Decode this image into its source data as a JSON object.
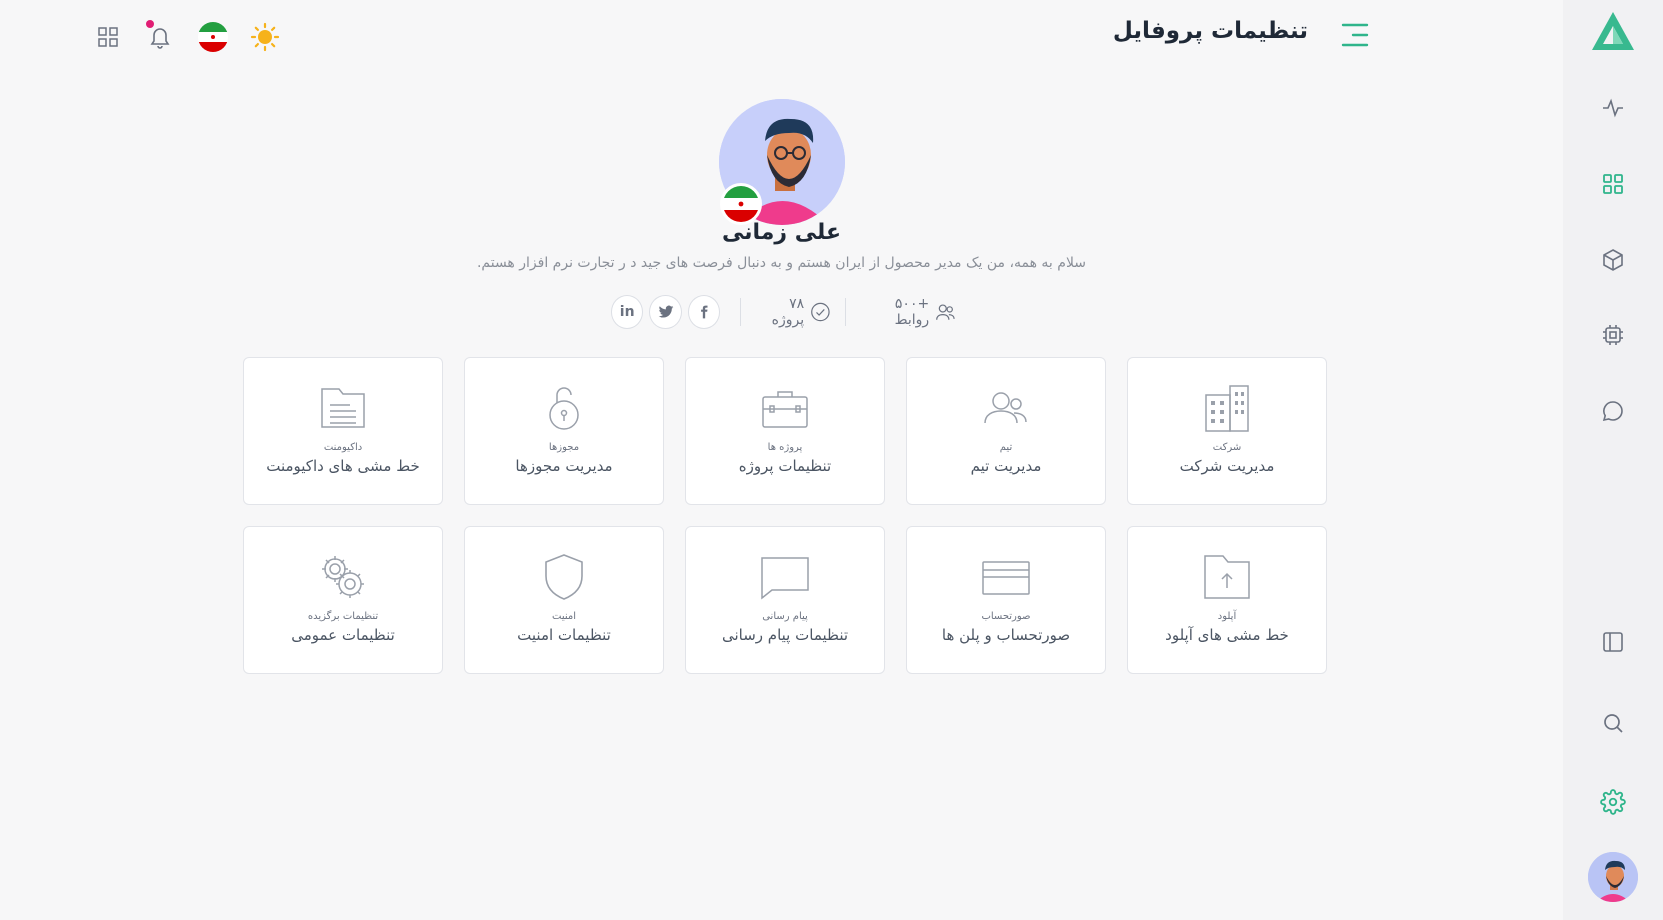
{
  "header": {
    "title": "تنظیمات پروفایل"
  },
  "profile": {
    "name": "علی زمانی",
    "bio": "سلام به همه، من یک مدیر محصول از ایران هستم و به دنبال فرصت های جید د ر تجارت نرم افزار هستم.",
    "connections": "+۵۰۰ روابط",
    "projects": "۷۸ پروژه",
    "social": {
      "linkedin": "in"
    }
  },
  "cards": [
    {
      "sub": "شرکت",
      "title": "مدیریت شرکت",
      "icon": "building-icon"
    },
    {
      "sub": "تیم",
      "title": "مدیریت تیم",
      "icon": "team-icon"
    },
    {
      "sub": "پروژه ها",
      "title": "تنظیمات پروژه",
      "icon": "briefcase-icon"
    },
    {
      "sub": "مجوزها",
      "title": "مدیریت مجوزها",
      "icon": "lock-icon"
    },
    {
      "sub": "داکیومنت",
      "title": "خط مشی های داکیومنت",
      "icon": "document-icon"
    },
    {
      "sub": "آپلود",
      "title": "خط مشی های آپلود",
      "icon": "upload-folder-icon"
    },
    {
      "sub": "صورتحساب",
      "title": "صورتحساب و پلن ها",
      "icon": "credit-card-icon"
    },
    {
      "sub": "پیام رسانی",
      "title": "تنظیمات پیام رسانی",
      "icon": "message-icon"
    },
    {
      "sub": "امنیت",
      "title": "تنظیمات امنیت",
      "icon": "shield-icon"
    },
    {
      "sub": "تنظیمات برگزیده",
      "title": "تنظیمات عمومی",
      "icon": "gears-icon"
    }
  ],
  "colors": {
    "accent": "#2fb58b",
    "notification_dot": "#e11d74",
    "avatar_bg": "#c7cffa"
  }
}
